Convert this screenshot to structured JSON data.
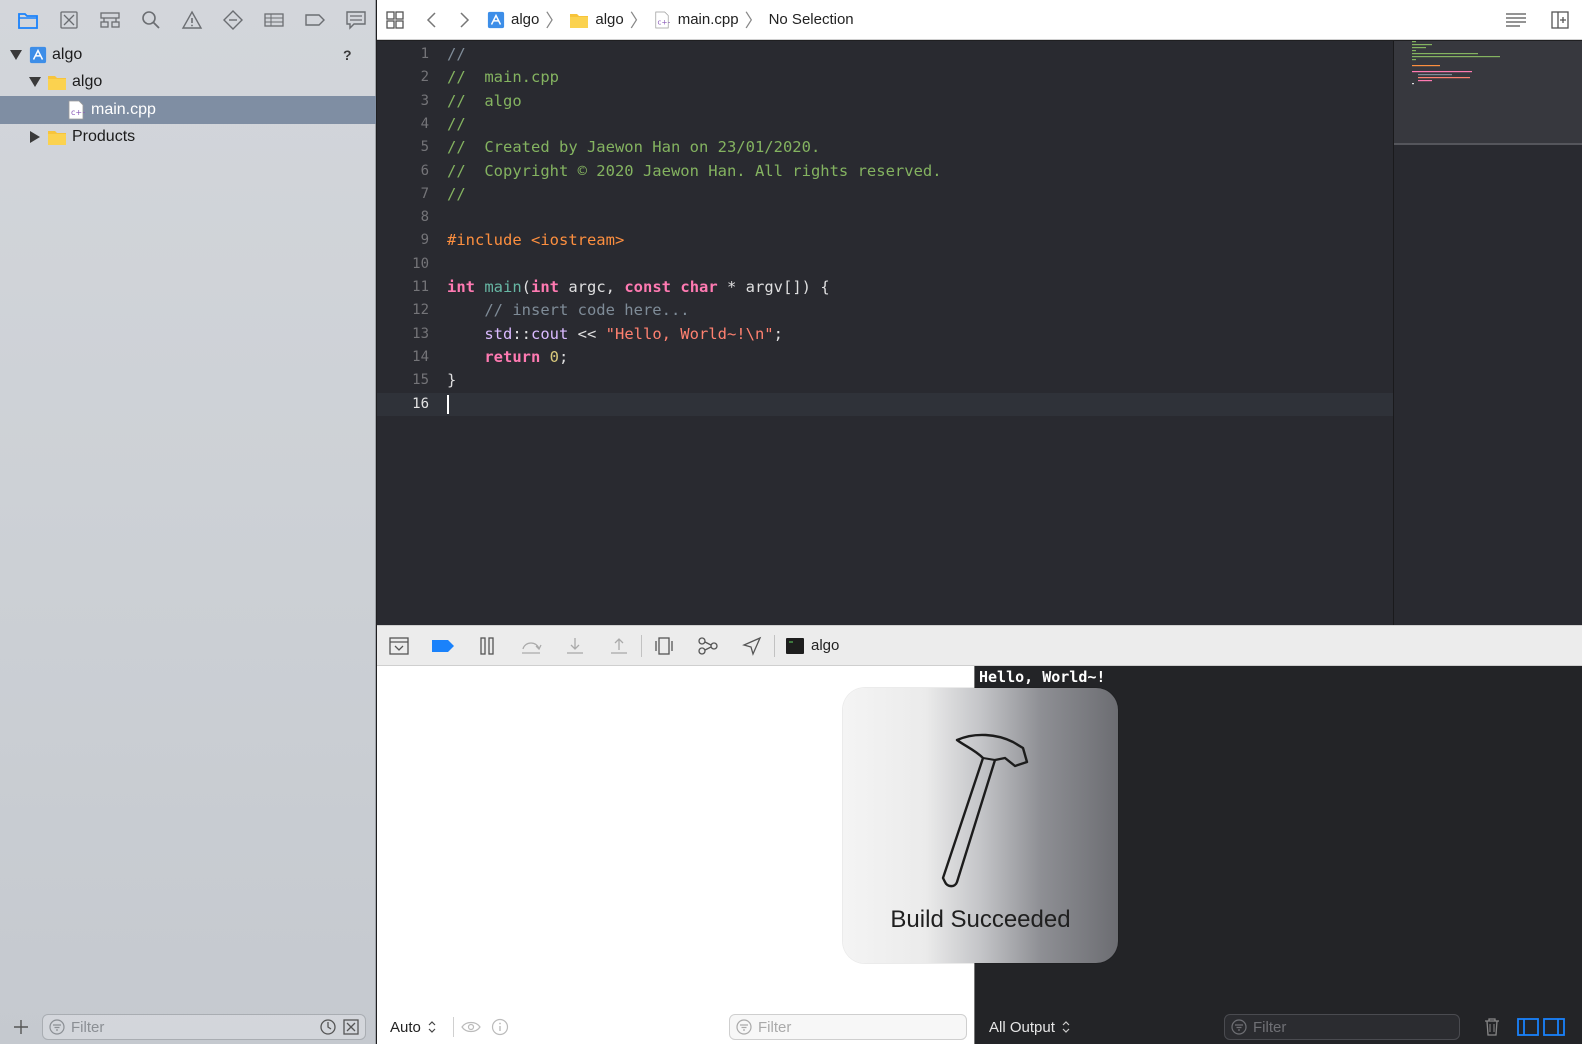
{
  "navigator": {
    "tabs": [
      {
        "name": "project-navigator-icon",
        "active": true
      },
      {
        "name": "source-control-icon"
      },
      {
        "name": "symbol-navigator-icon"
      },
      {
        "name": "find-navigator-icon"
      },
      {
        "name": "issue-navigator-icon"
      },
      {
        "name": "test-navigator-icon"
      },
      {
        "name": "debug-navigator-icon"
      },
      {
        "name": "breakpoint-navigator-icon"
      },
      {
        "name": "report-navigator-icon"
      }
    ],
    "tree": {
      "project": "algo",
      "project_badge": "?",
      "group": "algo",
      "file": "main.cpp",
      "products": "Products"
    },
    "filter_placeholder": "Filter"
  },
  "jumpbar": {
    "crumbs": [
      "algo",
      "algo",
      "main.cpp",
      "No Selection"
    ]
  },
  "editor": {
    "lines": [
      {
        "n": "1"
      },
      {
        "n": "2"
      },
      {
        "n": "3"
      },
      {
        "n": "4"
      },
      {
        "n": "5"
      },
      {
        "n": "6"
      },
      {
        "n": "7"
      },
      {
        "n": "8"
      },
      {
        "n": "9"
      },
      {
        "n": "10"
      },
      {
        "n": "11"
      },
      {
        "n": "12"
      },
      {
        "n": "13"
      },
      {
        "n": "14"
      },
      {
        "n": "15"
      },
      {
        "n": "16"
      }
    ],
    "code": {
      "l1": "//",
      "l2": "//  main.cpp",
      "l3": "//  algo",
      "l4": "//",
      "l5": "//  Created by Jaewon Han on 23/01/2020.",
      "l6": "//  Copyright © 2020 Jaewon Han. All rights reserved.",
      "l7": "//",
      "l9_pp": "#include",
      "l9_hdr": " <iostream>",
      "l11_int1": "int",
      "l11_main": "main",
      "l11_p1": "(",
      "l11_int2": "int",
      "l11_argc": " argc, ",
      "l11_const": "const",
      "l11_char": "char",
      "l11_rest": " * argv[]) {",
      "l12": "    // insert code here...",
      "l13_ns": "std",
      "l13_sep": "::",
      "l13_cout": "cout",
      "l13_op": " << ",
      "l13_str": "\"Hello, World~!\\n\"",
      "l13_end": ";",
      "l14_ret": "return",
      "l14_num": "0",
      "l14_end": ";",
      "l15": "}"
    },
    "current_line": 16
  },
  "debug_bar": {
    "target_label": "algo"
  },
  "variables_pane": {
    "scope": "Auto",
    "filter_placeholder": "Filter"
  },
  "console": {
    "output": "Hello, World~!",
    "output_selector": "All Output",
    "filter_placeholder": "Filter"
  },
  "hud": {
    "message": "Build Succeeded"
  },
  "colors": {
    "accent": "#1a82fb",
    "editor_bg": "#292a30",
    "comment": "#7f8c98",
    "keyword": "#ff7ab2",
    "string": "#ff8170",
    "preprocessor": "#fd8f3f"
  }
}
